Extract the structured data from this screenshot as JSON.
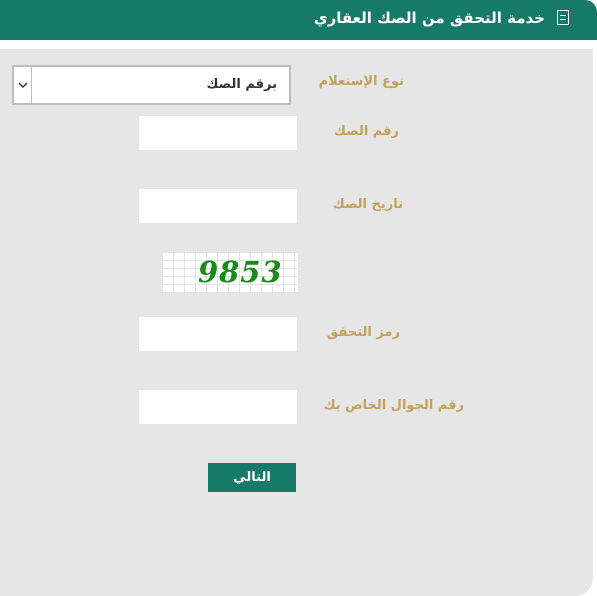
{
  "header": {
    "title": "خدمة التحقق من الصك العقاري",
    "icon": "document-icon"
  },
  "form": {
    "inquiry_type_label": "نوع الإستعلام",
    "inquiry_type_value": "برقم الصك",
    "deed_number_label": "رقم الصك",
    "deed_number_value": "",
    "deed_date_label": "تاريخ الصك",
    "deed_date_value": "",
    "captcha_text": "9853",
    "verification_code_label": "رمز التحقق",
    "verification_code_value": "",
    "mobile_label": "رقم الجوال الخاص بك",
    "mobile_value": "",
    "next_button": "التالي"
  },
  "colors": {
    "header": "#157a67",
    "label": "#c2a15b",
    "panel": "#e6e6e6",
    "captcha_text": "#1a8a1a"
  }
}
